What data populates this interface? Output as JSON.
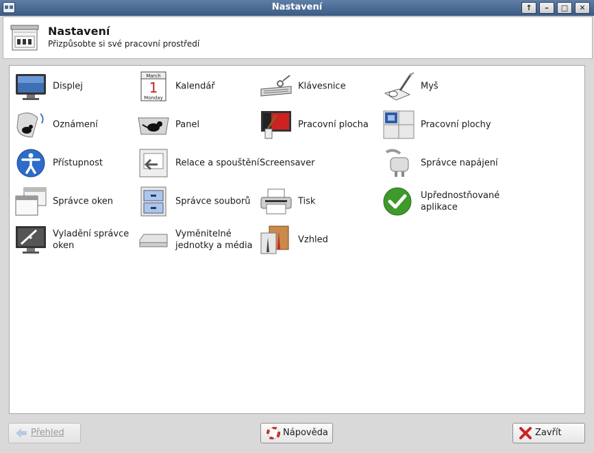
{
  "window": {
    "title": "Nastavení",
    "controls": {
      "up": "↑",
      "minimize": "–",
      "maximize": "□",
      "close": "✕"
    }
  },
  "header": {
    "title": "Nastavení",
    "subtitle": "Přizpůsobte si své pracovní prostředí",
    "icon": "settings-manager-icon"
  },
  "items": [
    {
      "label": "Displej",
      "icon": "display-icon"
    },
    {
      "label": "Kalendář",
      "icon": "calendar-icon",
      "icon_text": {
        "month": "March",
        "day": "1",
        "weekday": "Monday"
      }
    },
    {
      "label": "Klávesnice",
      "icon": "keyboard-icon"
    },
    {
      "label": "Myš",
      "icon": "mouse-icon"
    },
    {
      "label": "Oznámení",
      "icon": "notification-icon"
    },
    {
      "label": "Panel",
      "icon": "panel-icon"
    },
    {
      "label": "Pracovní plocha",
      "icon": "desktop-icon"
    },
    {
      "label": "Pracovní plochy",
      "icon": "workspaces-icon"
    },
    {
      "label": "Přístupnost",
      "icon": "accessibility-icon"
    },
    {
      "label": "Relace a spouštění",
      "icon": "session-icon"
    },
    {
      "label": "Screensaver",
      "icon": ""
    },
    {
      "label": "Správce napájení",
      "icon": "power-icon"
    },
    {
      "label": "Správce oken",
      "icon": "window-manager-icon"
    },
    {
      "label": "Správce souborů",
      "icon": "file-manager-icon"
    },
    {
      "label": "Tisk",
      "icon": "printer-icon"
    },
    {
      "label": "Upřednostňované aplikace",
      "icon": "preferred-apps-icon"
    },
    {
      "label": "Vyladění správce oken",
      "icon": "wm-tweaks-icon"
    },
    {
      "label": "Vyměnitelné jednotky a média",
      "icon": "removable-drive-icon"
    },
    {
      "label": "Vzhled",
      "icon": "appearance-icon"
    }
  ],
  "footer": {
    "overview_label": "Přehled",
    "help_label": "Nápověda",
    "close_label": "Zavřít"
  },
  "colors": {
    "titlebar": "#4a6b94",
    "accent_green": "#3e9a2a",
    "accent_red": "#cc2222"
  }
}
